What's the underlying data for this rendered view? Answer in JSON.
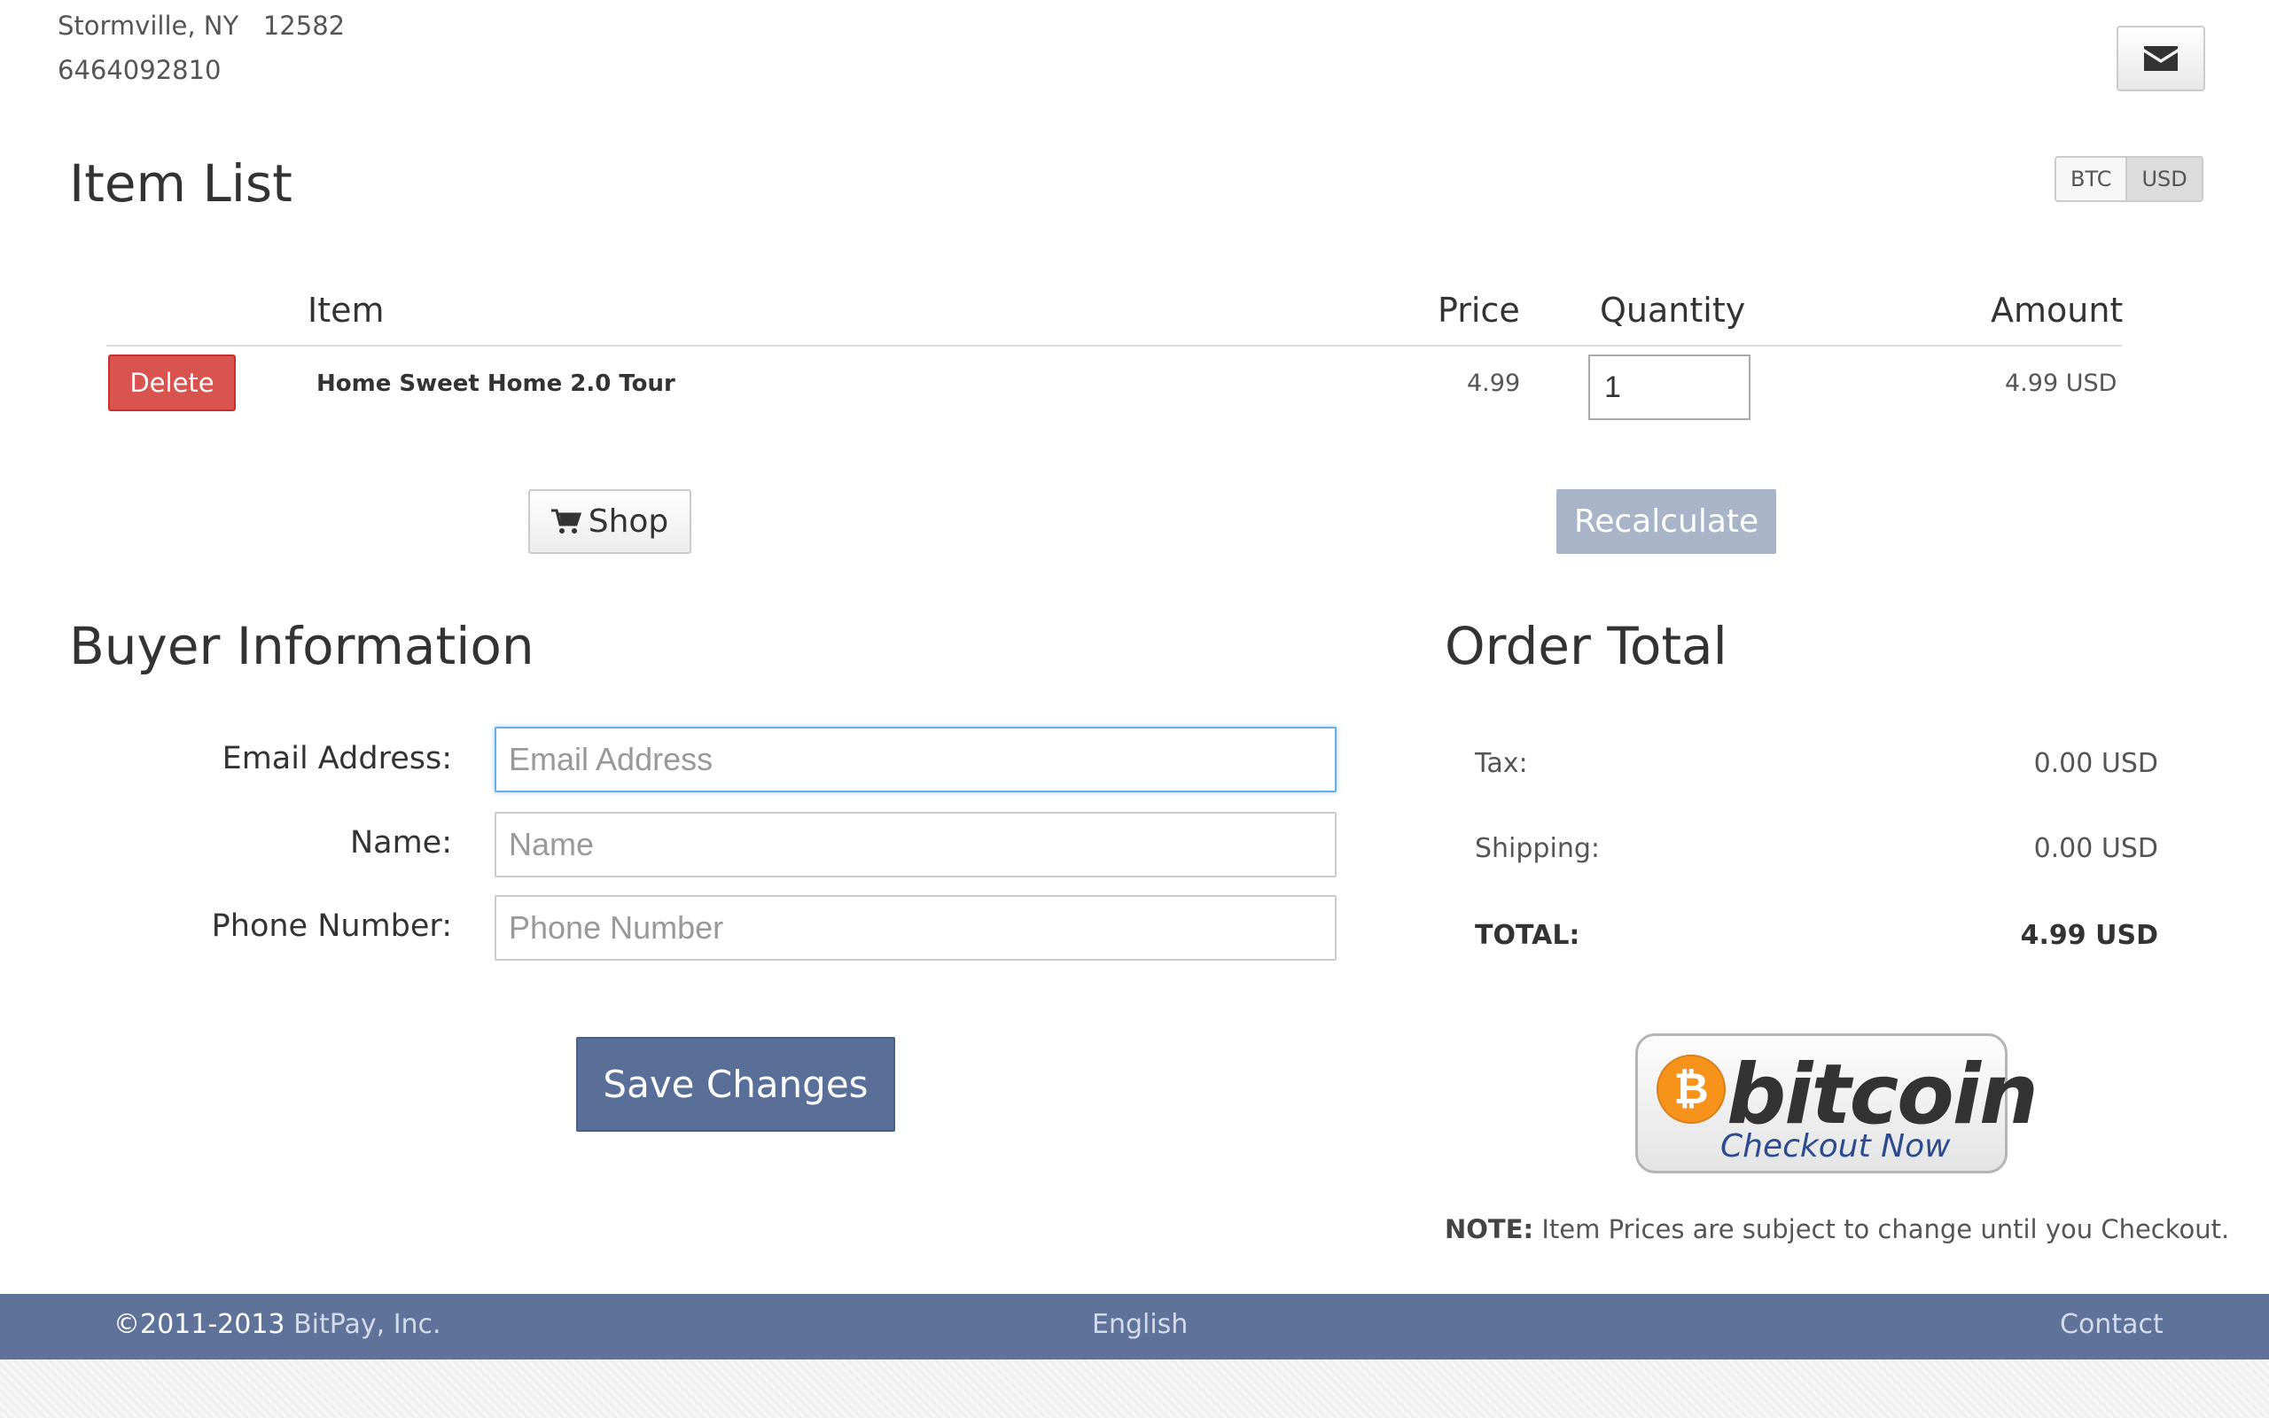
{
  "header": {
    "address_line1": "Stormville, NY   12582",
    "address_line2": "6464092810"
  },
  "item_list": {
    "title": "Item List",
    "currency_options": [
      "BTC",
      "USD"
    ],
    "selected_currency": "USD",
    "columns": {
      "item": "Item",
      "price": "Price",
      "quantity": "Quantity",
      "amount": "Amount"
    },
    "rows": [
      {
        "delete_label": "Delete",
        "name": "Home Sweet Home 2.0 Tour",
        "price": "4.99",
        "quantity": "1",
        "amount": "4.99 USD"
      }
    ],
    "shop_label": "Shop",
    "recalculate_label": "Recalculate"
  },
  "buyer": {
    "title": "Buyer Information",
    "email_label": "Email Address:",
    "email_placeholder": "Email Address",
    "name_label": "Name:",
    "name_placeholder": "Name",
    "phone_label": "Phone Number:",
    "phone_placeholder": "Phone Number",
    "save_label": "Save Changes"
  },
  "order_total": {
    "title": "Order Total",
    "tax_label": "Tax:",
    "tax_value": "0.00 USD",
    "shipping_label": "Shipping:",
    "shipping_value": "0.00 USD",
    "total_label": "TOTAL:",
    "total_value": "4.99 USD"
  },
  "checkout": {
    "symbol": "₿",
    "word": "bitcoin",
    "sub": "Checkout Now",
    "badge_color": "#f7931a"
  },
  "note": {
    "prefix": "NOTE:",
    "text": " Item Prices are subject to change until you Checkout."
  },
  "footer": {
    "copyright": "©2011-2013",
    "company": " BitPay, Inc.",
    "language": "English",
    "contact": "Contact"
  },
  "colors": {
    "accent": "#5a6f98",
    "delete": "#d9534f",
    "recalculate": "#aab4c8",
    "footer": "#5f7299"
  },
  "icons": [
    "envelope-icon",
    "cart-icon",
    "bitcoin-icon"
  ]
}
